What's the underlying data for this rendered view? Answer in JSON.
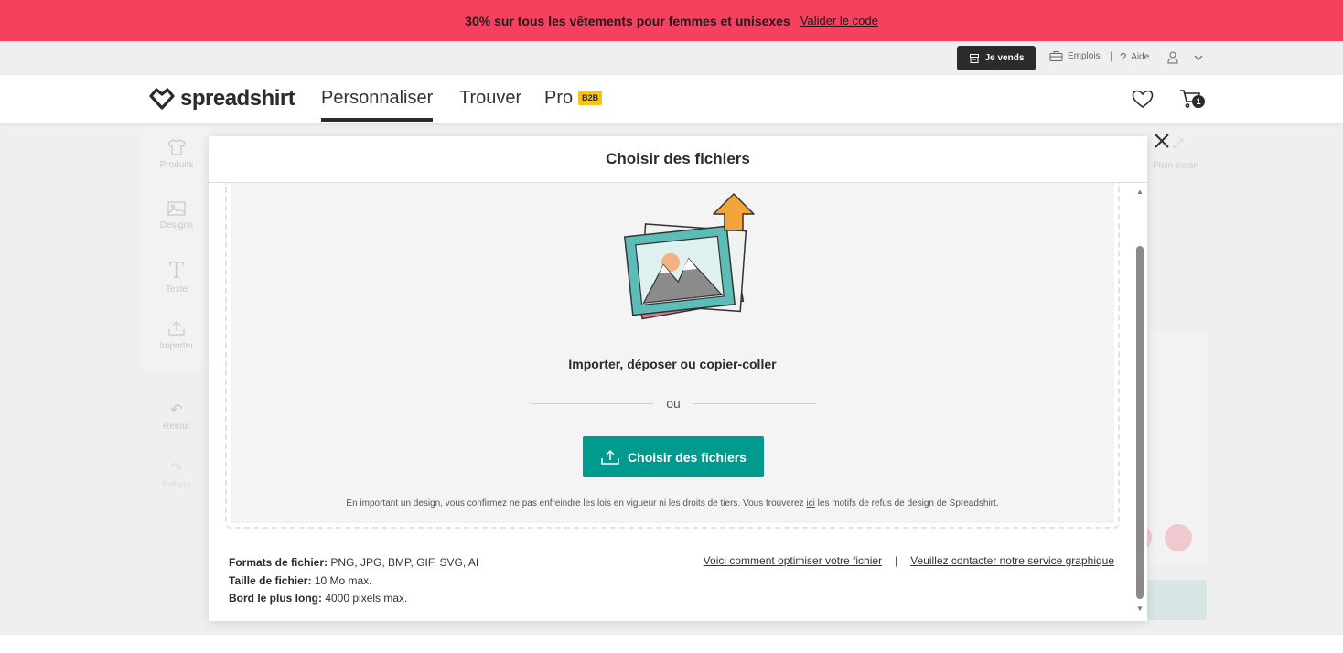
{
  "promo": {
    "text": "30% sur tous les vêtements pour femmes et unisexes",
    "link": "Valider le code"
  },
  "utility": {
    "sell_label": "Je vends",
    "jobs_label": "Emplois",
    "separator": "|",
    "help_icon_glyph": "?",
    "help_label": "Aide"
  },
  "nav": {
    "logo_text": "spreadshirt",
    "tabs": [
      {
        "label": "Personnaliser",
        "active": true
      },
      {
        "label": "Trouver"
      },
      {
        "label": "Pro"
      }
    ],
    "b2b_badge": "B2B",
    "cart_count": "1"
  },
  "sidebar": {
    "items": [
      {
        "label": "Produits",
        "icon": "tshirt-icon"
      },
      {
        "label": "Designs",
        "icon": "image-icon"
      },
      {
        "label": "Texte",
        "icon": "text-icon"
      },
      {
        "label": "Importer",
        "icon": "upload-icon"
      },
      {
        "label": "Retour",
        "icon": "undo-icon"
      },
      {
        "label": "Refaire",
        "icon": "redo-icon"
      }
    ]
  },
  "background": {
    "fullscreen_label": "Plein écran"
  },
  "modal": {
    "title": "Choisir des fichiers",
    "drop_title": "Importer, déposer ou copier-coller",
    "or_text": "ou",
    "choose_button": "Choisir des fichiers",
    "legal_before": "En important un design, vous confirmez ne pas enfreindre les lois en vigueur ni les droits de tiers. Vous trouverez ",
    "legal_link": "ici",
    "legal_after": " les motifs de refus de design de Spreadshirt.",
    "specs": {
      "formats_label": "Formats de fichier:",
      "formats_value": " PNG, JPG, BMP, GIF, SVG, AI",
      "size_label": "Taille de fichier:",
      "size_value": " 10 Mo max.",
      "edge_label": "Bord le plus long:",
      "edge_value": " 4000 pixels max."
    },
    "links": {
      "optimize": "Voici comment optimiser votre fichier",
      "separator": "|",
      "contact": "Veuillez contacter notre service graphique"
    }
  },
  "colors": {
    "promo_bg": "#f5415e",
    "primary_teal": "#009a8e",
    "badge_yellow": "#f7c21a",
    "dark": "#2b2b2b"
  }
}
